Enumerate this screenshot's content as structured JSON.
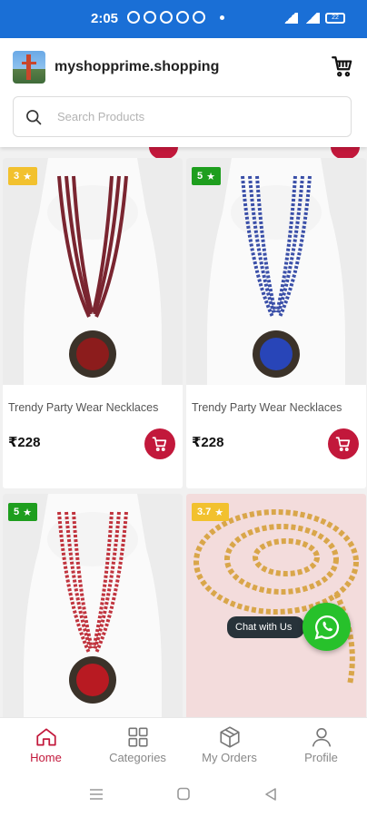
{
  "status_bar": {
    "time": "2:05",
    "battery": "22"
  },
  "header": {
    "site_title": "myshopprime.shopping",
    "cart_icon": "cart-icon",
    "logo_icon": "bridge-logo-icon"
  },
  "search": {
    "placeholder": "Search Products",
    "value": ""
  },
  "products": [
    {
      "rating": "3",
      "name": "Trendy Party Wear Necklaces",
      "price": "₹228",
      "bead_color": "#7a2530",
      "pendant_color": "#8c1c1c"
    },
    {
      "rating": "5",
      "name": "Trendy Party Wear Necklaces",
      "price": "₹228",
      "bead_color": "#3a4fa8",
      "pendant_color": "#2845b8"
    },
    {
      "rating": "5",
      "name": "",
      "price": "",
      "bead_color": "#c0333d",
      "pendant_color": "#b81a22"
    },
    {
      "rating": "3.7",
      "name": "",
      "price": "",
      "bead_color": "#d9a64a",
      "pendant_color": "#d9a64a"
    }
  ],
  "chat": {
    "label": "Chat with Us",
    "icon": "whatsapp-icon"
  },
  "bottom_nav": [
    {
      "label": "Home",
      "icon": "home-icon",
      "active": true
    },
    {
      "label": "Categories",
      "icon": "grid-icon",
      "active": false
    },
    {
      "label": "My Orders",
      "icon": "package-icon",
      "active": false
    },
    {
      "label": "Profile",
      "icon": "user-icon",
      "active": false
    }
  ],
  "colors": {
    "accent": "#c2183b",
    "status_bar": "#1a6fd6",
    "rating_green": "#1e9e1e",
    "rating_yellow": "#f2c12e",
    "whatsapp": "#27c12b"
  }
}
